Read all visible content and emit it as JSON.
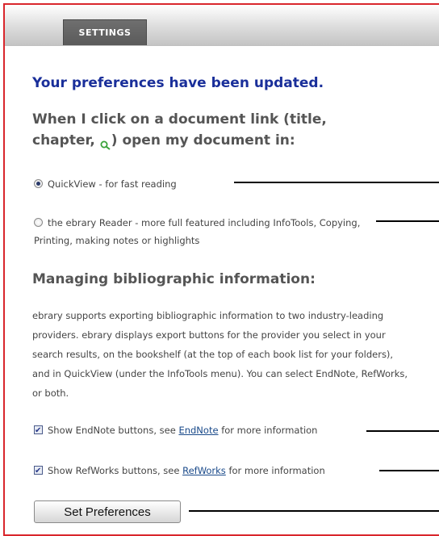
{
  "tabs": [
    {
      "label": "SETTINGS"
    }
  ],
  "status": {
    "message": "Your preferences have been updated."
  },
  "open_section": {
    "heading_line1": "When I click on a document link (title,",
    "heading_line2_pre": "chapter,",
    "heading_line2_post": ") open my document in:",
    "icon": "magnifier-icon",
    "options": [
      {
        "label": "QuickView - for fast reading",
        "selected": true
      },
      {
        "label": "the ebrary Reader - more full featured including InfoTools, Copying, Printing, making notes or highlights",
        "selected": false
      }
    ]
  },
  "biblio_section": {
    "heading": "Managing bibliographic information:",
    "description": "ebrary supports exporting bibliographic information to two industry-leading providers. ebrary displays export buttons for the provider you select in your search results, on the bookshelf (at the top of each book list for your folders), and in QuickView (under the InfoTools menu). You can select EndNote, RefWorks, or both.",
    "endnote": {
      "pre": "Show EndNote buttons, see",
      "link": "EndNote",
      "post": "for more information",
      "checked": true
    },
    "refworks": {
      "pre": "Show RefWorks buttons, see",
      "link": "RefWorks",
      "post": "for more information",
      "checked": true
    }
  },
  "submit": {
    "label": "Set Preferences"
  },
  "colors": {
    "accent": "#1a2f9a",
    "frame": "#d9262c",
    "link": "#1a4a8a"
  }
}
